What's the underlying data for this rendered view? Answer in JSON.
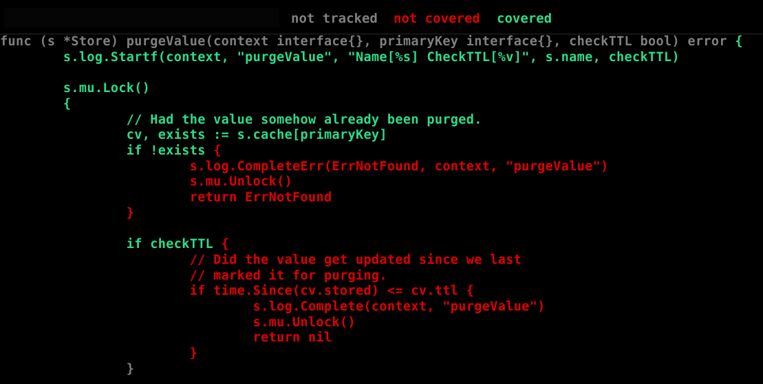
{
  "toolbar": {
    "file_select_value": "",
    "legend": {
      "not_tracked": "not tracked",
      "not_covered": "not covered",
      "covered": "covered"
    }
  },
  "colors": {
    "not_tracked": "#808080",
    "not_covered": "#e00000",
    "covered": "#2ddc8a",
    "background": "#000000"
  },
  "code_lines": [
    {
      "segments": [
        {
          "text": "func (s *Store) purgeValue(context interface{}, primaryKey interface{}, checkTTL bool) error ",
          "cls": "gray"
        },
        {
          "text": "{",
          "cls": "green"
        }
      ]
    },
    {
      "segments": [
        {
          "text": "        s.log.Startf(context, \"purgeValue\", \"Name[%s] CheckTTL[%v]\", s.name, checkTTL)",
          "cls": "green"
        }
      ]
    },
    {
      "segments": [
        {
          "text": "",
          "cls": "gray"
        }
      ]
    },
    {
      "segments": [
        {
          "text": "        s.mu.Lock()",
          "cls": "green"
        }
      ]
    },
    {
      "segments": [
        {
          "text": "        {",
          "cls": "green"
        }
      ]
    },
    {
      "segments": [
        {
          "text": "                // Had the value somehow already been purged.",
          "cls": "green"
        }
      ]
    },
    {
      "segments": [
        {
          "text": "                cv, exists := s.cache[primaryKey]",
          "cls": "green"
        }
      ]
    },
    {
      "segments": [
        {
          "text": "                if !exists ",
          "cls": "green"
        },
        {
          "text": "{",
          "cls": "red"
        }
      ]
    },
    {
      "segments": [
        {
          "text": "                        s.log.CompleteErr(ErrNotFound, context, \"purgeValue\")",
          "cls": "red"
        }
      ]
    },
    {
      "segments": [
        {
          "text": "                        s.mu.Unlock()",
          "cls": "red"
        }
      ]
    },
    {
      "segments": [
        {
          "text": "                        return ErrNotFound",
          "cls": "red"
        }
      ]
    },
    {
      "segments": [
        {
          "text": "                }",
          "cls": "red"
        }
      ]
    },
    {
      "segments": [
        {
          "text": "",
          "cls": "gray"
        }
      ]
    },
    {
      "segments": [
        {
          "text": "                if checkTTL ",
          "cls": "green"
        },
        {
          "text": "{",
          "cls": "red"
        }
      ]
    },
    {
      "segments": [
        {
          "text": "                        // Did the value get updated since we last",
          "cls": "red"
        }
      ]
    },
    {
      "segments": [
        {
          "text": "                        // marked it for purging.",
          "cls": "red"
        }
      ]
    },
    {
      "segments": [
        {
          "text": "                        if time.Since(cv.stored) <= cv.ttl {",
          "cls": "red"
        }
      ]
    },
    {
      "segments": [
        {
          "text": "                                s.log.Complete(context, \"purgeValue\")",
          "cls": "red"
        }
      ]
    },
    {
      "segments": [
        {
          "text": "                                s.mu.Unlock()",
          "cls": "red"
        }
      ]
    },
    {
      "segments": [
        {
          "text": "                                return nil",
          "cls": "red"
        }
      ]
    },
    {
      "segments": [
        {
          "text": "                        }",
          "cls": "red"
        }
      ]
    },
    {
      "segments": [
        {
          "text": "                }",
          "cls": "gray"
        }
      ]
    }
  ]
}
